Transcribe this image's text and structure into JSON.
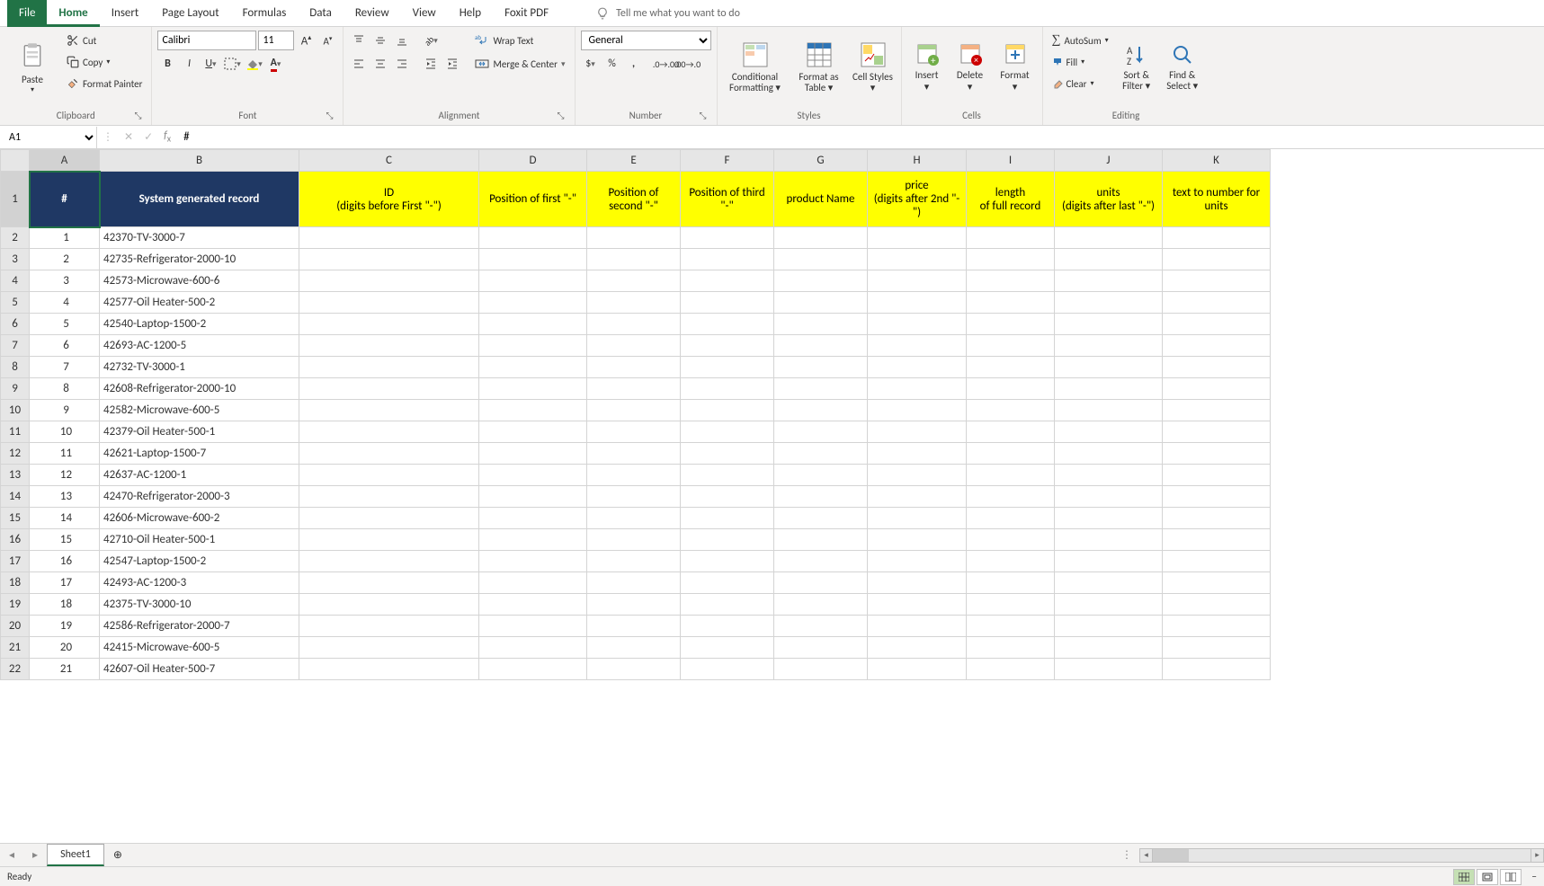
{
  "tabs": [
    "File",
    "Home",
    "Insert",
    "Page Layout",
    "Formulas",
    "Data",
    "Review",
    "View",
    "Help",
    "Foxit PDF"
  ],
  "activeTab": "Home",
  "tellMe": "Tell me what you want to do",
  "clipboard": {
    "paste": "Paste",
    "cut": "Cut",
    "copy": "Copy",
    "fp": "Format Painter",
    "label": "Clipboard"
  },
  "font": {
    "name": "Calibri",
    "size": "11",
    "label": "Font"
  },
  "alignment": {
    "wrap": "Wrap Text",
    "merge": "Merge & Center",
    "label": "Alignment"
  },
  "number": {
    "format": "General",
    "label": "Number"
  },
  "styles": {
    "cond": "Conditional Formatting",
    "table": "Format as Table",
    "cell": "Cell Styles",
    "label": "Styles"
  },
  "cells": {
    "insert": "Insert",
    "delete": "Delete",
    "format": "Format",
    "label": "Cells"
  },
  "editing": {
    "sum": "AutoSum",
    "fill": "Fill",
    "clear": "Clear",
    "sort": "Sort & Filter",
    "find": "Find & Select",
    "label": "Editing"
  },
  "nameBox": "A1",
  "formulaValue": "#",
  "columns": [
    "A",
    "B",
    "C",
    "D",
    "E",
    "F",
    "G",
    "H",
    "I",
    "J",
    "K"
  ],
  "headers": {
    "A": "#",
    "B": "System generated record",
    "C": "ID\n(digits before First \"-\")",
    "D": "Position of first \"-\"",
    "E": "Position of second \"-\"",
    "F": "Position of third \"-\"",
    "G": "product Name",
    "H": "price\n(digits after 2nd  \"-\")",
    "I": "length\nof full record",
    "J": "units\n(digits after last \"-\")",
    "K": "text to number for units"
  },
  "rows": [
    {
      "n": 1,
      "rec": "42370-TV-3000-7"
    },
    {
      "n": 2,
      "rec": "42735-Refrigerator-2000-10"
    },
    {
      "n": 3,
      "rec": "42573-Microwave-600-6"
    },
    {
      "n": 4,
      "rec": "42577-Oil Heater-500-2"
    },
    {
      "n": 5,
      "rec": "42540-Laptop-1500-2"
    },
    {
      "n": 6,
      "rec": "42693-AC-1200-5"
    },
    {
      "n": 7,
      "rec": "42732-TV-3000-1"
    },
    {
      "n": 8,
      "rec": "42608-Refrigerator-2000-10"
    },
    {
      "n": 9,
      "rec": "42582-Microwave-600-5"
    },
    {
      "n": 10,
      "rec": "42379-Oil Heater-500-1"
    },
    {
      "n": 11,
      "rec": "42621-Laptop-1500-7"
    },
    {
      "n": 12,
      "rec": "42637-AC-1200-1"
    },
    {
      "n": 13,
      "rec": "42470-Refrigerator-2000-3"
    },
    {
      "n": 14,
      "rec": "42606-Microwave-600-2"
    },
    {
      "n": 15,
      "rec": "42710-Oil Heater-500-1"
    },
    {
      "n": 16,
      "rec": "42547-Laptop-1500-2"
    },
    {
      "n": 17,
      "rec": "42493-AC-1200-3"
    },
    {
      "n": 18,
      "rec": "42375-TV-3000-10"
    },
    {
      "n": 19,
      "rec": "42586-Refrigerator-2000-7"
    },
    {
      "n": 20,
      "rec": "42415-Microwave-600-5"
    },
    {
      "n": 21,
      "rec": "42607-Oil Heater-500-7"
    }
  ],
  "sheetName": "Sheet1",
  "status": "Ready"
}
